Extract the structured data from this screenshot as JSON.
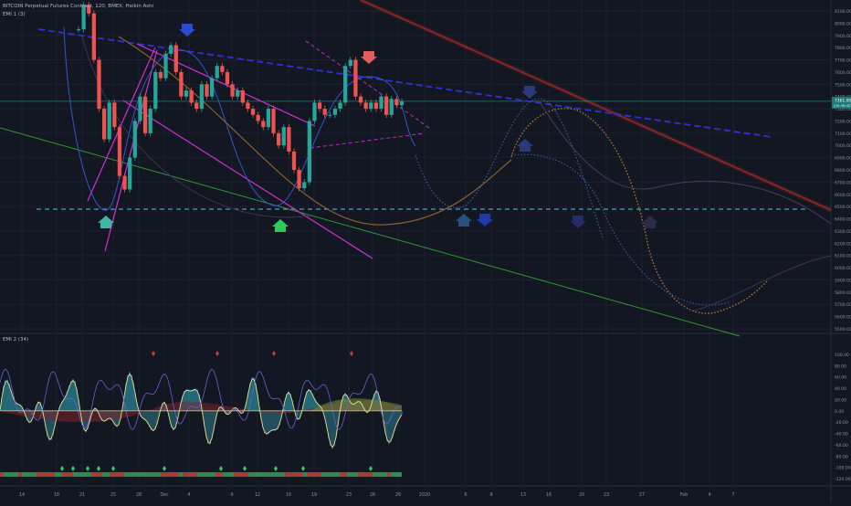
{
  "chart_data": {
    "type": "line",
    "header": {
      "symbol_line": "BITCOIN Perpetual Futures Contract, 120, BMEX, Heikin Ashi",
      "indicator_1": "EMI 1 (3)",
      "indicator_2": "EMI 2 (34)"
    },
    "price_axis": {
      "ticks": [
        "8100.00",
        "7900.00",
        "7700.00",
        "7500.00",
        "7300.00",
        "7100.00",
        "6900.00",
        "6700.00",
        "6500.00",
        "6300.00",
        "6100.00",
        "5900.00",
        "5700.00",
        "5500.00"
      ],
      "extra_ticks": [
        "8000.00",
        "7800.00",
        "7600.00",
        "7400.00",
        "7200.00",
        "7000.00",
        "6800.00",
        "6600.00",
        "6400.00",
        "6200.00",
        "6000.00",
        "5800.00",
        "5600.00"
      ],
      "current_price_label": "7361.00",
      "current_price_sublabel": "[00:36:42]"
    },
    "osc_axis": {
      "ticks": [
        "100.00",
        "80.00",
        "60.00",
        "40.00",
        "20.00",
        "0.00",
        "-20.00",
        "-40.00",
        "-60.00",
        "-80.00",
        "-100.00",
        "-120.00"
      ]
    },
    "time_axis": {
      "ticks": [
        "14",
        "18",
        "21",
        "25",
        "28",
        "Dec",
        "4",
        "9",
        "12",
        "16",
        "19",
        "23",
        "26",
        "29",
        "2020",
        "6",
        "9",
        "13",
        "16",
        "20",
        "23",
        "27",
        "Feb",
        "4",
        "7"
      ]
    },
    "price_series": {
      "name": "",
      "values": [
        7950,
        8150,
        8080,
        7700,
        7300,
        7050,
        7350,
        7150,
        6750,
        6640,
        6900,
        7200,
        7400,
        7100,
        7300,
        7600,
        7550,
        7750,
        7820,
        7600,
        7400,
        7450,
        7350,
        7300,
        7500,
        7400,
        7550,
        7650,
        7600,
        7500,
        7400,
        7450,
        7350,
        7300,
        7250,
        7200,
        7150,
        7300,
        7100,
        7000,
        7150,
        6950,
        6800,
        6650,
        6700,
        7200,
        7350,
        7300,
        7250,
        7250,
        7300,
        7350,
        7650,
        7700,
        7400,
        7350,
        7300,
        7350,
        7300,
        7400,
        7250,
        7380,
        7330,
        7361
      ]
    },
    "colors": {
      "background": "#131722",
      "bull_candle": "#26a69a",
      "bear_candle": "#ef5350",
      "trend_dashed": "#3030d8",
      "support_dashed": "#4aa3b5",
      "red_trend": "#a52a2a",
      "green_trend": "#33a833",
      "magenta": "#d52dd5",
      "arrow_blue": "#2f49d1",
      "arrow_red": "#e35d5d",
      "arrow_teal": "#3fb5a4",
      "arrow_green": "#2dcc5a"
    }
  }
}
